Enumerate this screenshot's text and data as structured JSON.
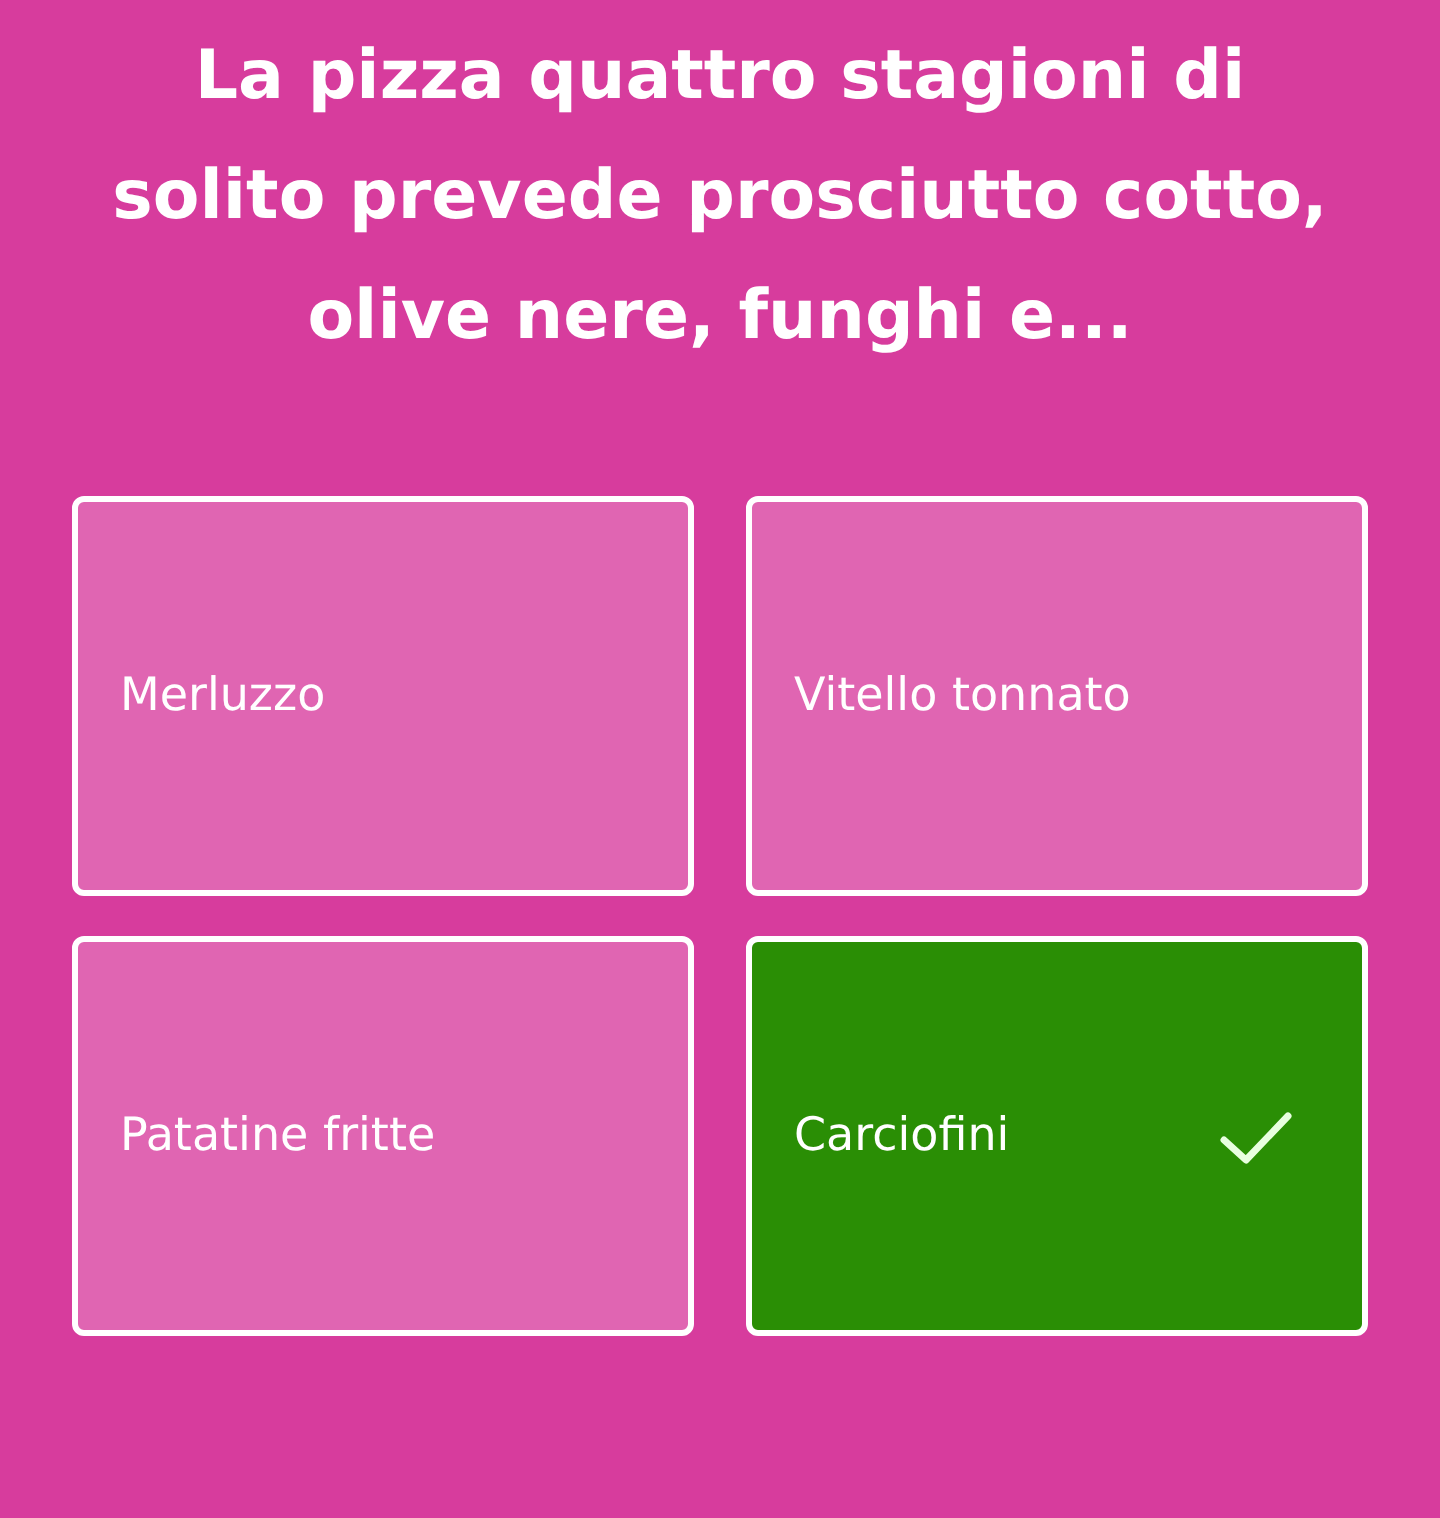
{
  "question": "La pizza quattro stagioni di solito prevede prosciutto cotto, olive nere, funghi e...",
  "answers": [
    {
      "label": "Merluzzo",
      "correct": false
    },
    {
      "label": "Vitello tonnato",
      "correct": false
    },
    {
      "label": "Patatine fritte",
      "correct": false
    },
    {
      "label": "Carciofini",
      "correct": true
    }
  ]
}
